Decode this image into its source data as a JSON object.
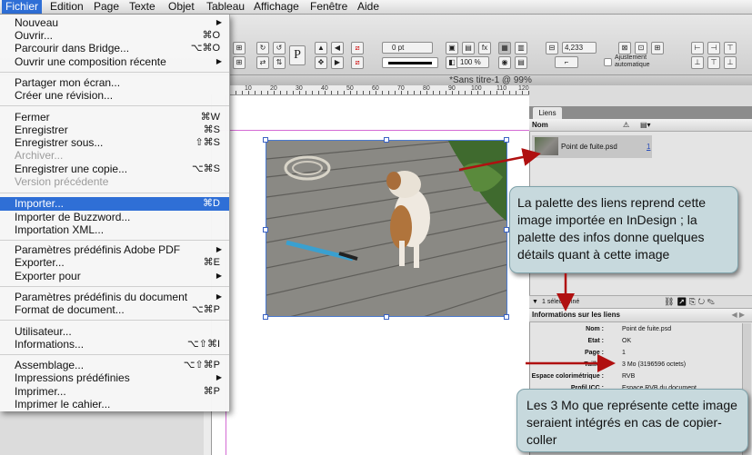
{
  "menubar": {
    "items": [
      "Fichier",
      "Edition",
      "Page",
      "Texte",
      "Objet",
      "Tableau",
      "Affichage",
      "Fenêtre",
      "Aide"
    ],
    "active": "Fichier"
  },
  "document": {
    "title": "*Sans titre-1 @ 99%"
  },
  "toolbar": {
    "stroke_weight": "0 pt",
    "zoom": "100 %",
    "width_value": "4,233 mm",
    "auto_fit_label_1": "Ajustement",
    "auto_fit_label_2": "automatique"
  },
  "ruler": {
    "labels": [
      "10",
      "20",
      "30",
      "40",
      "50",
      "60",
      "70",
      "80",
      "90",
      "100",
      "110",
      "120"
    ]
  },
  "file_menu": {
    "items": [
      {
        "label": "Nouveau",
        "shortcut": "",
        "submenu": true,
        "disabled": false
      },
      {
        "label": "Ouvrir...",
        "shortcut": "⌘O",
        "submenu": false,
        "disabled": false
      },
      {
        "label": "Parcourir dans Bridge...",
        "shortcut": "⌥⌘O",
        "submenu": false,
        "disabled": false
      },
      {
        "label": "Ouvrir une composition récente",
        "shortcut": "",
        "submenu": true,
        "disabled": false
      },
      {
        "label": "Partager mon écran...",
        "shortcut": "",
        "submenu": false,
        "disabled": false
      },
      {
        "label": "Créer une révision...",
        "shortcut": "",
        "submenu": false,
        "disabled": false
      },
      {
        "label": "Fermer",
        "shortcut": "⌘W",
        "submenu": false,
        "disabled": false
      },
      {
        "label": "Enregistrer",
        "shortcut": "⌘S",
        "submenu": false,
        "disabled": false
      },
      {
        "label": "Enregistrer sous...",
        "shortcut": "⇧⌘S",
        "submenu": false,
        "disabled": false
      },
      {
        "label": "Archiver...",
        "shortcut": "",
        "submenu": false,
        "disabled": true
      },
      {
        "label": "Enregistrer une copie...",
        "shortcut": "⌥⌘S",
        "submenu": false,
        "disabled": false
      },
      {
        "label": "Version précédente",
        "shortcut": "",
        "submenu": false,
        "disabled": true
      },
      {
        "label": "Importer...",
        "shortcut": "⌘D",
        "submenu": false,
        "disabled": false,
        "highlighted": true
      },
      {
        "label": "Importer de Buzzword...",
        "shortcut": "",
        "submenu": false,
        "disabled": false
      },
      {
        "label": "Importation XML...",
        "shortcut": "",
        "submenu": false,
        "disabled": false
      },
      {
        "label": "Paramètres prédéfinis Adobe PDF",
        "shortcut": "",
        "submenu": true,
        "disabled": false
      },
      {
        "label": "Exporter...",
        "shortcut": "⌘E",
        "submenu": false,
        "disabled": false
      },
      {
        "label": "Exporter pour",
        "shortcut": "",
        "submenu": true,
        "disabled": false
      },
      {
        "label": "Paramètres prédéfinis du document",
        "shortcut": "",
        "submenu": true,
        "disabled": false
      },
      {
        "label": "Format de document...",
        "shortcut": "⌥⌘P",
        "submenu": false,
        "disabled": false
      },
      {
        "label": "Utilisateur...",
        "shortcut": "",
        "submenu": false,
        "disabled": false
      },
      {
        "label": "Informations...",
        "shortcut": "⌥⇧⌘I",
        "submenu": false,
        "disabled": false
      },
      {
        "label": "Assemblage...",
        "shortcut": "⌥⇧⌘P",
        "submenu": false,
        "disabled": false
      },
      {
        "label": "Impressions prédéfinies",
        "shortcut": "",
        "submenu": true,
        "disabled": false
      },
      {
        "label": "Imprimer...",
        "shortcut": "⌘P",
        "submenu": false,
        "disabled": false
      },
      {
        "label": "Imprimer le cahier...",
        "shortcut": "",
        "submenu": false,
        "disabled": false
      }
    ]
  },
  "links_panel": {
    "tab": "Liens",
    "column_name": "Nom",
    "link": {
      "name": "Point de fuite.psd",
      "page": "1"
    },
    "status": "1 sélectionné",
    "info_header": "Informations sur les liens",
    "info": [
      {
        "key": "Nom :",
        "value": "Point de fuite.psd"
      },
      {
        "key": "Etat :",
        "value": "OK"
      },
      {
        "key": "Page :",
        "value": "1"
      },
      {
        "key": "Taille :",
        "value": "3 Mo (3196596 octets)"
      },
      {
        "key": "Espace colorimétrique :",
        "value": "RVB"
      },
      {
        "key": "Profil ICC :",
        "value": "Espace RVB du document"
      }
    ]
  },
  "callouts": {
    "links": "La palette des liens reprend  cette image importée en InDesign ; la palette des infos donne quelques détails quant à cette image",
    "size": "Les 3 Mo que représente cette image seraient intégrés en cas de copier-coller"
  },
  "colors": {
    "menu_highlight": "#2f6fd6",
    "callout_bg": "#c7d9dd",
    "arrow": "#b01010"
  }
}
